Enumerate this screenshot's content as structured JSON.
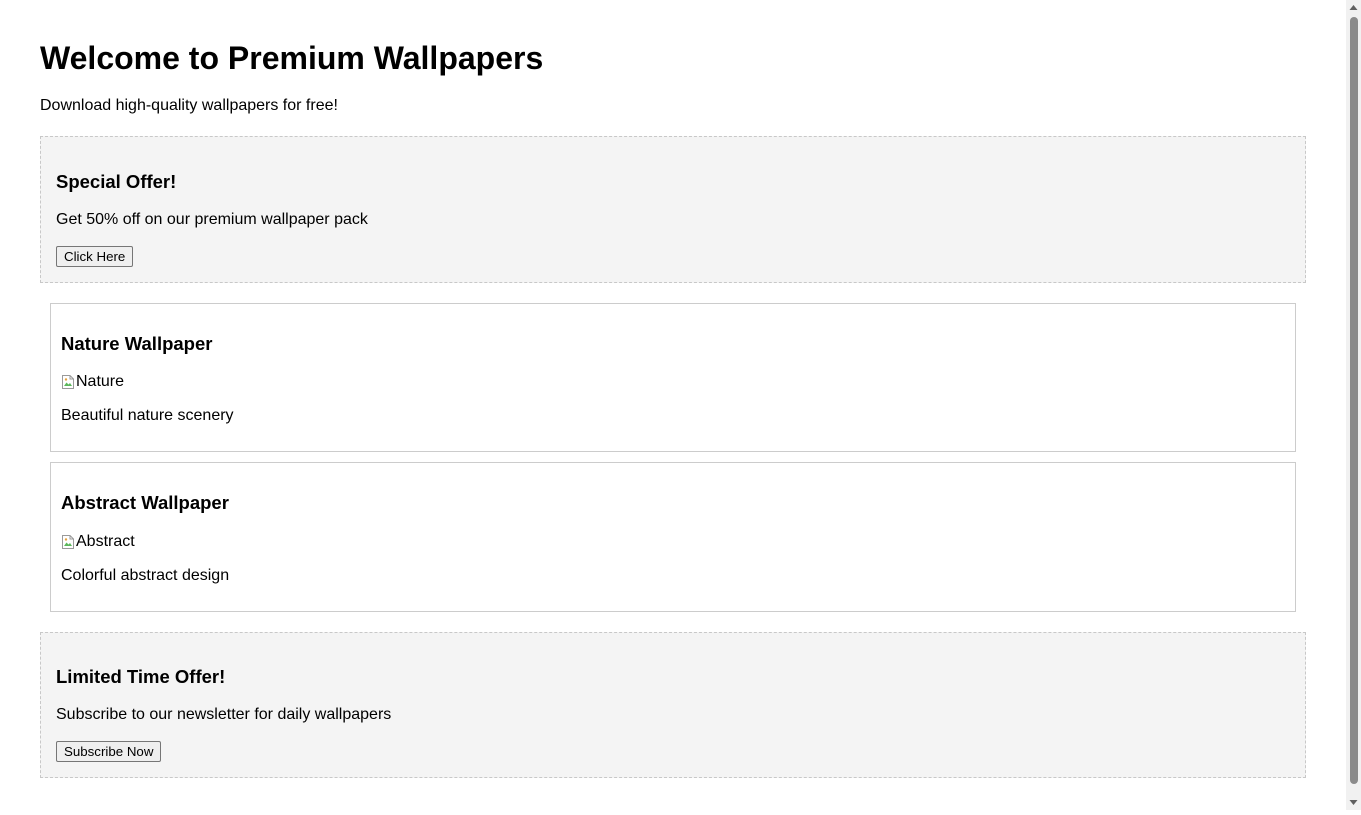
{
  "header": {
    "title": "Welcome to Premium Wallpapers",
    "subtitle": "Download high-quality wallpapers for free!"
  },
  "offers": [
    {
      "title": "Special Offer!",
      "text": "Get 50% off on our premium wallpaper pack",
      "button_label": "Click Here"
    },
    {
      "title": "Limited Time Offer!",
      "text": "Subscribe to our newsletter for daily wallpapers",
      "button_label": "Subscribe Now"
    }
  ],
  "wallpapers": [
    {
      "title": "Nature Wallpaper",
      "image_alt": "Nature",
      "description": "Beautiful nature scenery"
    },
    {
      "title": "Abstract Wallpaper",
      "image_alt": "Abstract",
      "description": "Colorful abstract design"
    }
  ],
  "icons": {
    "broken_image": "broken-image-icon",
    "scroll_up": "scroll-up-arrow-icon",
    "scroll_down": "scroll-down-arrow-icon"
  },
  "colors": {
    "offer_background": "#f4f4f4",
    "offer_border": "#c8c8c8",
    "card_border": "#cccccc",
    "scroll_thumb": "#8b8b8b"
  }
}
